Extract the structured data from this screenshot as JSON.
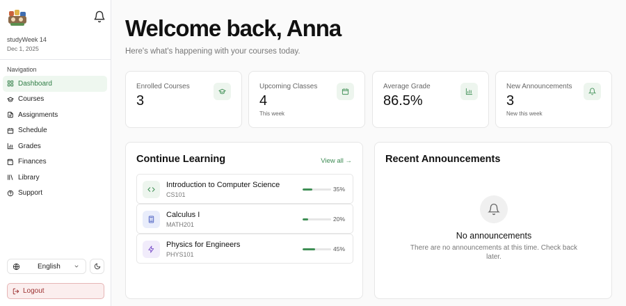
{
  "sidebar": {
    "app_name": "studyWeek 14",
    "date": "Dec 1, 2025",
    "nav_title": "Navigation",
    "items": [
      {
        "label": "Dashboard",
        "icon": "dashboard-icon",
        "active": true
      },
      {
        "label": "Courses",
        "icon": "courses-icon"
      },
      {
        "label": "Assignments",
        "icon": "assignments-icon"
      },
      {
        "label": "Schedule",
        "icon": "calendar-icon"
      },
      {
        "label": "Grades",
        "icon": "grades-chart-icon"
      },
      {
        "label": "Finances",
        "icon": "wallet-icon"
      },
      {
        "label": "Library",
        "icon": "library-icon"
      },
      {
        "label": "Support",
        "icon": "help-icon"
      }
    ],
    "language": "English",
    "logout_label": "Logout"
  },
  "header": {
    "welcome": "Welcome back, Anna",
    "subtitle": "Here's what's happening with your courses today."
  },
  "stats": [
    {
      "label": "Enrolled Courses",
      "value": "3",
      "note": "",
      "icon": "graduation-cap-icon"
    },
    {
      "label": "Upcoming Classes",
      "value": "4",
      "note": "This week",
      "icon": "calendar-icon"
    },
    {
      "label": "Average Grade",
      "value": "86.5%",
      "note": "",
      "icon": "bar-chart-icon"
    },
    {
      "label": "New Announcements",
      "value": "3",
      "note": "New this week",
      "icon": "bell-icon"
    }
  ],
  "continue_learning": {
    "title": "Continue Learning",
    "view_all": "View all →",
    "courses": [
      {
        "title": "Introduction to Computer Science",
        "code": "CS101",
        "progress": 35,
        "progress_label": "35%",
        "icon": "code-icon",
        "icon_bg": "#edf5ee",
        "icon_color": "#3f8f55"
      },
      {
        "title": "Calculus I",
        "code": "MATH201",
        "progress": 20,
        "progress_label": "20%",
        "icon": "calculator-icon",
        "icon_bg": "#e9edfb",
        "icon_color": "#4a5fc1"
      },
      {
        "title": "Physics for Engineers",
        "code": "PHYS101",
        "progress": 45,
        "progress_label": "45%",
        "icon": "lightning-icon",
        "icon_bg": "#f1ecfb",
        "icon_color": "#7a4fc9"
      }
    ]
  },
  "announcements": {
    "title": "Recent Announcements",
    "empty_title": "No announcements",
    "empty_desc": "There are no announcements at this time. Check back later."
  },
  "colors": {
    "accent": "#3f8f55",
    "logout_bg": "#fbeeee",
    "logout_text": "#9b2f2f"
  }
}
